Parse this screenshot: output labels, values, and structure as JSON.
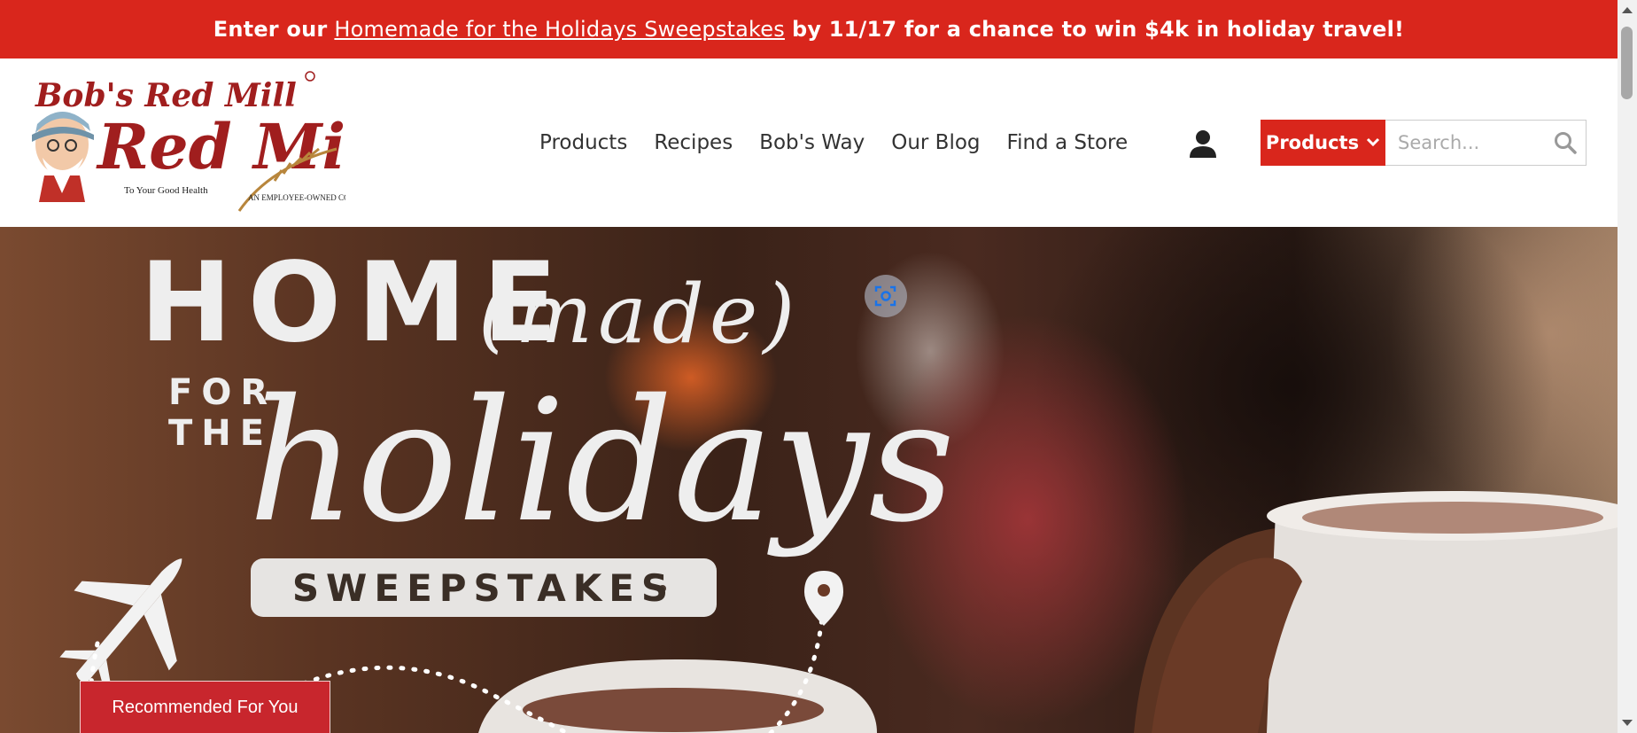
{
  "promo": {
    "prefix": "Enter our",
    "link": "Homemade for the Holidays Sweepstakes",
    "suffix": "by 11/17 for a chance to win $4k in holiday travel!"
  },
  "logo": {
    "brand": "Bob's Red Mill",
    "tagline": "To Your Good Health",
    "badge": "AN EMPLOYEE-OWNED COMPANY"
  },
  "nav": {
    "items": [
      {
        "label": "Products"
      },
      {
        "label": "Recipes"
      },
      {
        "label": "Bob's Way"
      },
      {
        "label": "Our Blog"
      },
      {
        "label": "Find a Store"
      }
    ]
  },
  "search": {
    "category_label": "Products",
    "placeholder": "Search..."
  },
  "hero": {
    "line1": "HOME",
    "line1_script": "(made)",
    "line2_small_1": "FOR",
    "line2_small_2": "THE",
    "line2_script": "holidays",
    "badge": "SWEEPSTAKES"
  },
  "recommended": {
    "label": "Recommended For You"
  },
  "colors": {
    "brand_red": "#d9261c",
    "button_red": "#c8262d"
  }
}
